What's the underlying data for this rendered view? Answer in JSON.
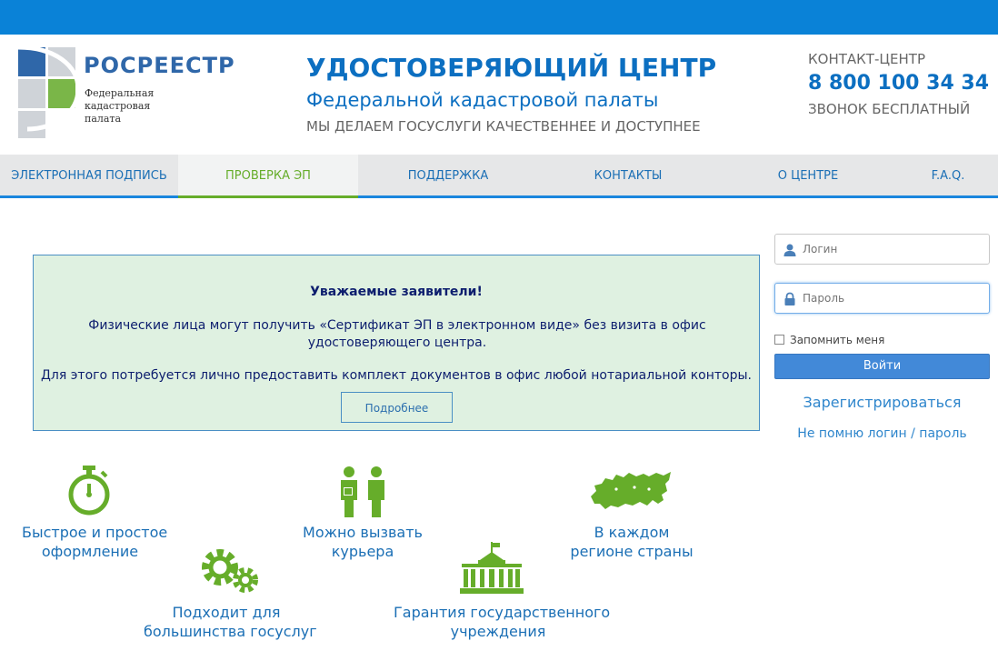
{
  "header": {
    "logo_name": "РОСРЕЕСТР",
    "logo_sub": "Федеральная кадастровая палата",
    "title": "УДОСТОВЕРЯЮЩИЙ ЦЕНТР",
    "subtitle": "Федеральной кадастровой палаты",
    "slogan": "МЫ ДЕЛАЕМ ГОСУСЛУГИ КАЧЕСТВЕННЕЕ И ДОСТУПНЕЕ",
    "contact_label": "КОНТАКТ-ЦЕНТР",
    "contact_phone": "8 800 100 34 34",
    "contact_free": "ЗВОНОК БЕСПЛАТНЫЙ"
  },
  "nav": {
    "items": [
      {
        "label": "ЭЛЕКТРОННАЯ ПОДПИСЬ"
      },
      {
        "label": "ПРОВЕРКА ЭП"
      },
      {
        "label": "ПОДДЕРЖКА"
      },
      {
        "label": "КОНТАКТЫ"
      },
      {
        "label": "О ЦЕНТРЕ"
      },
      {
        "label": "F.A.Q."
      }
    ],
    "active": "ПРОВЕРКА ЭП"
  },
  "notice": {
    "title": "Уважаемые заявители!",
    "p1": "Физические лица могут получить «Сертификат ЭП в электронном виде» без визита в офис удостоверяющего центра.",
    "p2": "Для этого потребуется лично предоставить комплект документов в офис любой нотариальной конторы.",
    "button": "Подробнее"
  },
  "login": {
    "login_placeholder": "Логин",
    "password_placeholder": "Пароль",
    "remember": "Запомнить меня",
    "submit": "Войти",
    "register": "Зарегистрироваться",
    "forgot": "Не помню логин / пароль"
  },
  "features": {
    "fast_line1": "Быстрое и простое",
    "fast_line2": "оформление",
    "courier_line1": "Можно вызвать",
    "courier_line2": "курьера",
    "region_line1": "В каждом",
    "region_line2": "регионе страны",
    "services_line1": "Подходит для",
    "services_line2": "большинства госуслуг",
    "guarantee_line1": "Гарантия государственного",
    "guarantee_line2": "учреждения"
  },
  "colors": {
    "top_bar": "#0a82d7",
    "brand_blue": "#0c6fc1",
    "accent_green": "#66ad2a",
    "notice_bg": "#dff1e1"
  }
}
